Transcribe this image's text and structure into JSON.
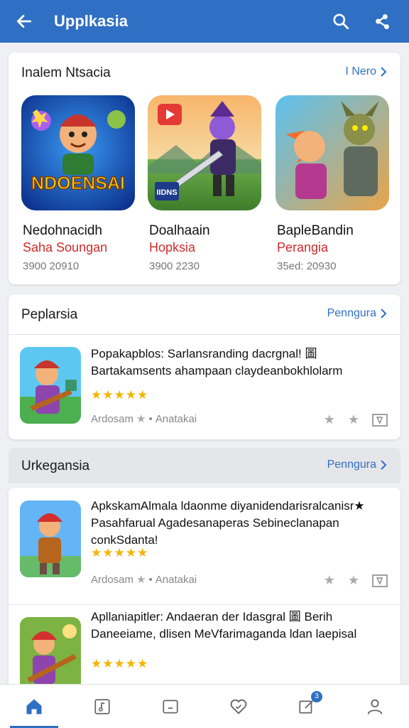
{
  "appbar": {
    "title": "Upplkasia",
    "background": "#2f6fc4"
  },
  "featured": {
    "title": "Inalem Ntsacia",
    "link": "I Nero",
    "apps": [
      {
        "name": "Nedohnacidh",
        "sub": "Saha Soungan",
        "meta": "3900 20910",
        "logo_text": "NDOENSAI"
      },
      {
        "name": "Doalhaain",
        "sub": "Hopksia",
        "meta": "3900 2230",
        "logo_text": "IIDNS"
      },
      {
        "name": "BapleBandin",
        "sub": "Perangia",
        "meta": "35ed: 20930"
      }
    ]
  },
  "popular": {
    "title": "Peplarsia",
    "link": "Penngura",
    "items": [
      {
        "desc": "Popakapblos: Sarlansranding dacrgnal! 圖 Bartakamsents ahampaan claydeanbokhlolarm",
        "stars": "★★★★★",
        "author": "Ardosam",
        "sep": "•",
        "tag": "Anatakai"
      }
    ]
  },
  "urgent": {
    "title": "Urkegansia",
    "link": "Penngura",
    "items": [
      {
        "desc": "ApkskamAlmala ldaonme diyanidendarisralcanisr★ Pasahfarual Agadesanaperas Sebineclanapan conkSdanta!",
        "stars": "★★★★★",
        "author": "Ardosam",
        "sep": "•",
        "tag": "Anatakai"
      },
      {
        "desc": "Apllaniapitler: Andaeran der Idasgral 圖 Berih Daneeiame, dlisen MeVfarimaganda ldan laepisal",
        "stars": "★★★★★"
      }
    ]
  },
  "bottom_nav": {
    "badge": "3"
  },
  "colors": {
    "accent": "#2f6fc4",
    "star": "#f4b400",
    "red": "#d02b2b"
  }
}
